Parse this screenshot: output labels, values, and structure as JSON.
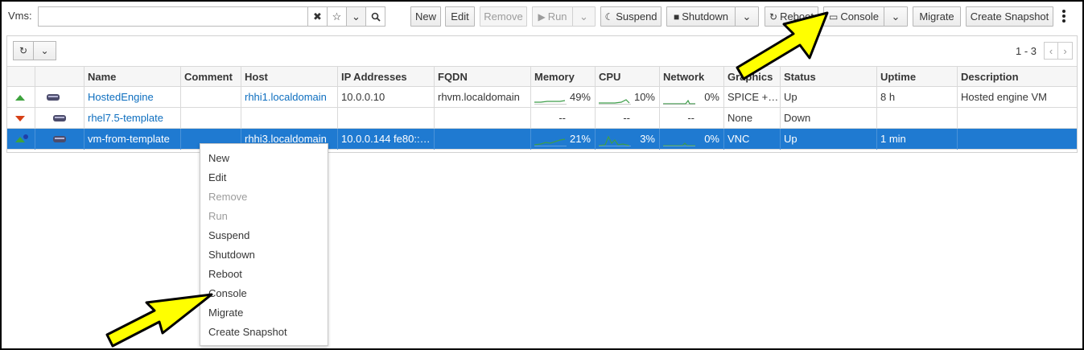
{
  "search": {
    "label": "Vms:",
    "value": "",
    "placeholder": ""
  },
  "toolbar": {
    "new": "New",
    "edit": "Edit",
    "remove": "Remove",
    "run": "Run",
    "suspend": "Suspend",
    "shutdown": "Shutdown",
    "reboot": "Reboot",
    "console": "Console",
    "migrate": "Migrate",
    "create_snapshot": "Create Snapshot"
  },
  "pager": {
    "range": "1 - 3"
  },
  "table": {
    "headers": [
      "Name",
      "Comment",
      "Host",
      "IP Addresses",
      "FQDN",
      "Memory",
      "CPU",
      "Network",
      "Graphics",
      "Status",
      "Uptime",
      "Description"
    ],
    "rows": [
      {
        "name": "HostedEngine",
        "comment": "",
        "host": "rhhi1.localdomain",
        "ip": "10.0.0.10",
        "fqdn": "rhvm.localdomain",
        "memory": "49%",
        "cpu": "10%",
        "network": "0%",
        "graphics": "SPICE + V...",
        "status": "Up",
        "uptime": "8 h",
        "description": "Hosted engine VM"
      },
      {
        "name": "rhel7.5-template",
        "comment": "",
        "host": "",
        "ip": "",
        "fqdn": "",
        "memory": "--",
        "cpu": "--",
        "network": "--",
        "graphics": "None",
        "status": "Down",
        "uptime": "",
        "description": ""
      },
      {
        "name": "vm-from-template",
        "comment": "",
        "host": "rhhi3.localdomain",
        "ip": "10.0.0.144 fe80::2...",
        "fqdn": "",
        "memory": "21%",
        "cpu": "3%",
        "network": "0%",
        "graphics": "VNC",
        "status": "Up",
        "uptime": "1 min",
        "description": ""
      }
    ]
  },
  "context_menu": {
    "items": [
      "New",
      "Edit",
      "Remove",
      "Run",
      "Suspend",
      "Shutdown",
      "Reboot",
      "Console",
      "Migrate",
      "Create Snapshot"
    ]
  },
  "colors": {
    "selected_row": "#1f7ad1",
    "link": "#0d6ebf",
    "status_up": "#3ea33e",
    "status_down": "#d64016",
    "annotation_arrow": "#ffff00"
  }
}
